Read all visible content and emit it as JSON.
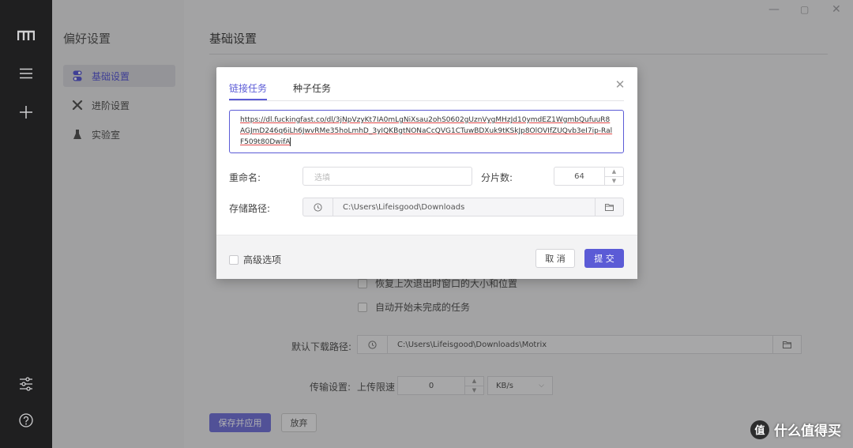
{
  "left_rail": {
    "icons": [
      "motrix-logo-icon",
      "menu-icon",
      "add-icon",
      "settings-sliders-icon",
      "help-icon"
    ]
  },
  "preferences": {
    "title": "偏好设置",
    "items": [
      {
        "label": "基础设置",
        "icon": "toggle-icon",
        "active": true
      },
      {
        "label": "进阶设置",
        "icon": "tools-icon",
        "active": false
      },
      {
        "label": "实验室",
        "icon": "lab-icon",
        "active": false
      }
    ]
  },
  "main": {
    "title": "基础设置",
    "checkboxes": [
      {
        "label": "恢复上次退出时窗口的大小和位置"
      },
      {
        "label": "自动开始未完成的任务"
      }
    ],
    "default_download_label": "默认下载路径:",
    "default_download_path": "C:\\Users\\Lifeisgood\\Downloads\\Motrix",
    "transfer_label": "传输设置:",
    "upload_limit_label": "上传限速",
    "upload_limit_value": "0",
    "upload_limit_unit": "KB/s",
    "save_button": "保存并应用",
    "discard_button": "放弃"
  },
  "dialog": {
    "tabs": [
      {
        "label": "链接任务",
        "active": true
      },
      {
        "label": "种子任务",
        "active": false
      }
    ],
    "url_underlined": "https://dl.fuckingfast.co/dl/3jNpVzyKt7IA0mLgNiXsau2ohS0602gUznVygMHzJd10ymdEZ1WgmbQufuuR8AGJmD246q6iLh6JwvRMe35hoLmhD",
    "url_rest": "_3yIQKBgtNONaCcQVG1CTuwBDXuk9tKSkJp8OlOVIfZUQvb3eI7ip-RalF509t80DwifA",
    "rename_label": "重命名:",
    "rename_placeholder": "选填",
    "split_label": "分片数:",
    "split_value": "64",
    "storage_label": "存储路径:",
    "storage_path": "C:\\Users\\Lifeisgood\\Downloads",
    "advanced_label": "高级选项",
    "cancel_label": "取 消",
    "submit_label": "提 交",
    "accent": "#5b5bd6"
  },
  "watermark": {
    "badge": "值",
    "text": "什么值得买"
  }
}
